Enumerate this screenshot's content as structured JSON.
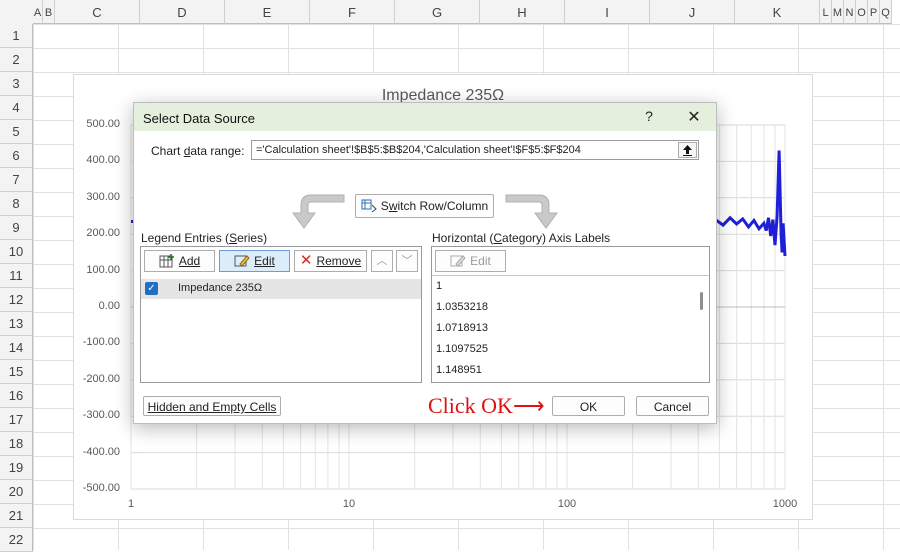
{
  "spreadsheet": {
    "columns": [
      "A",
      "B",
      "C",
      "D",
      "E",
      "F",
      "G",
      "H",
      "I",
      "J",
      "K",
      "L",
      "M",
      "N",
      "O",
      "P",
      "Q"
    ],
    "rows": [
      "1",
      "2",
      "3",
      "4",
      "5",
      "6",
      "7",
      "8",
      "9",
      "10",
      "11",
      "12",
      "13",
      "14",
      "15",
      "16",
      "17",
      "18",
      "19",
      "20",
      "21",
      "22"
    ]
  },
  "chart": {
    "title": "Impedance 235Ω",
    "y_ticks": [
      "500.00",
      "400.00",
      "300.00",
      "200.00",
      "100.00",
      "0.00",
      "-100.00",
      "-200.00",
      "-300.00",
      "-400.00",
      "-500.00"
    ],
    "x_ticks": [
      "1",
      "10",
      "100",
      "1000"
    ],
    "line_color": "#1f1fd6"
  },
  "chart_data": {
    "type": "line",
    "title": "Impedance 235Ω",
    "x_scale": "log",
    "xlim": [
      1,
      1000
    ],
    "ylim": [
      -500,
      500
    ],
    "series": [
      {
        "name": "Impedance 235Ω",
        "x": [
          1,
          1.0353218,
          1.0718913,
          1.1097525,
          1.148951,
          480,
          520,
          560,
          600,
          640,
          680,
          720,
          760,
          800,
          820,
          840,
          860,
          880,
          900,
          920,
          940,
          960,
          970,
          980,
          1000
        ],
        "y": [
          235,
          235,
          235,
          235,
          235,
          240,
          225,
          245,
          228,
          242,
          220,
          238,
          215,
          230,
          210,
          245,
          195,
          240,
          170,
          250,
          430,
          200,
          150,
          230,
          140
        ]
      }
    ]
  },
  "dialog": {
    "title": "Select Data Source",
    "help_icon": "?",
    "close_icon": "✕",
    "chart_range_label_pre": "Chart ",
    "chart_range_label_u": "d",
    "chart_range_label_post": "ata range:",
    "chart_range_value": "='Calculation sheet'!$B$5:$B$204,'Calculation sheet'!$F$5:$F$204",
    "switch_label_pre": "S",
    "switch_label_u": "w",
    "switch_label_post": "itch Row/Column",
    "legend_title_pre": "Legend Entries (",
    "legend_title_u": "S",
    "legend_title_post": "eries)",
    "add_label": "Add",
    "edit_label": "Edit",
    "remove_label": "Remove",
    "series_items": [
      {
        "label": "Impedance 235Ω",
        "checked": true
      }
    ],
    "axis_title_pre": "Horizontal (",
    "axis_title_u": "C",
    "axis_title_post": "ategory) Axis Labels",
    "axis_edit_label": "Edit",
    "category_items": [
      "1",
      "1.0353218",
      "1.0718913",
      "1.1097525",
      "1.148951"
    ],
    "hidden_cells_label": "Hidden and Empty Cells",
    "ok_label": "OK",
    "cancel_label": "Cancel"
  },
  "annotation": {
    "text": "Click OK⟶",
    "color": "#d11111"
  }
}
